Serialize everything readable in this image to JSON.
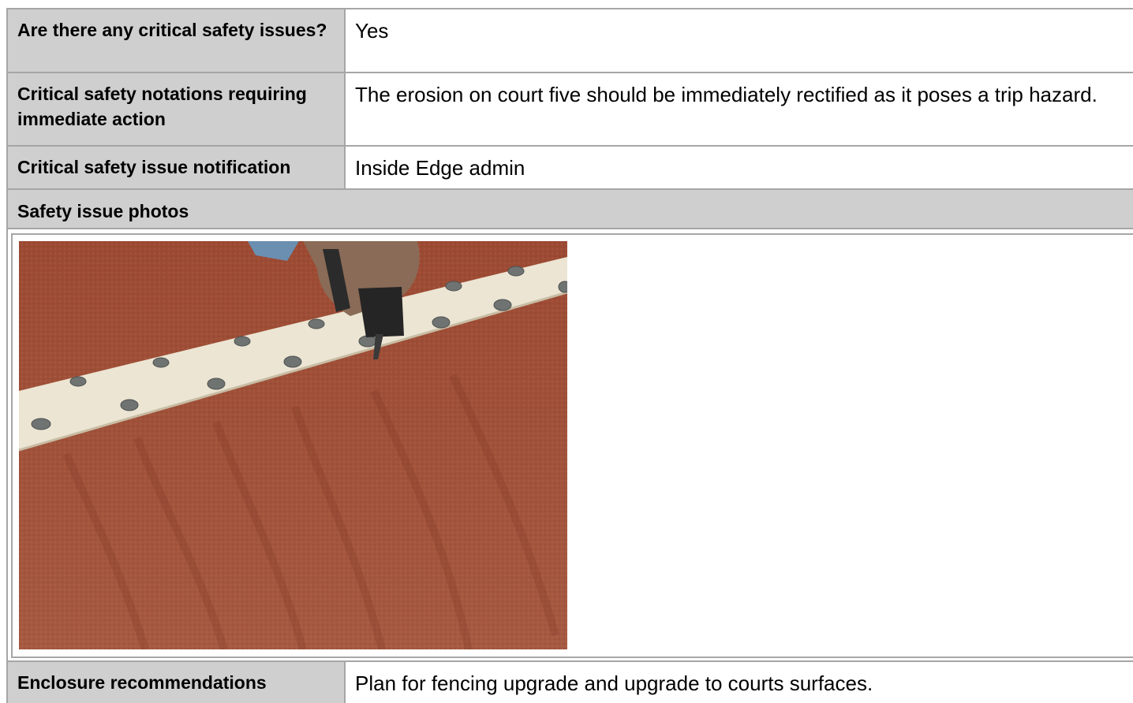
{
  "rows": [
    {
      "label": "Are there any critical safety issues?",
      "value": "Yes"
    },
    {
      "label": "Critical safety notations requiring immediate action",
      "value": "The erosion on court five should be immediately rectified as it poses a trip hazard."
    },
    {
      "label": "Critical safety issue notification",
      "value": "Inside Edge admin"
    }
  ],
  "photos_section": {
    "title": "Safety issue photos",
    "photo": "eroded-clay-court-edge-photo"
  },
  "enclosure": {
    "label": "Enclosure recommendations",
    "value": "Plan for fencing upgrade and upgrade to courts surfaces."
  },
  "colors": {
    "label_bg": "#cfcfcf",
    "border": "#a6a6a6",
    "clay": "#a8553d",
    "line": "#ece5d3"
  }
}
